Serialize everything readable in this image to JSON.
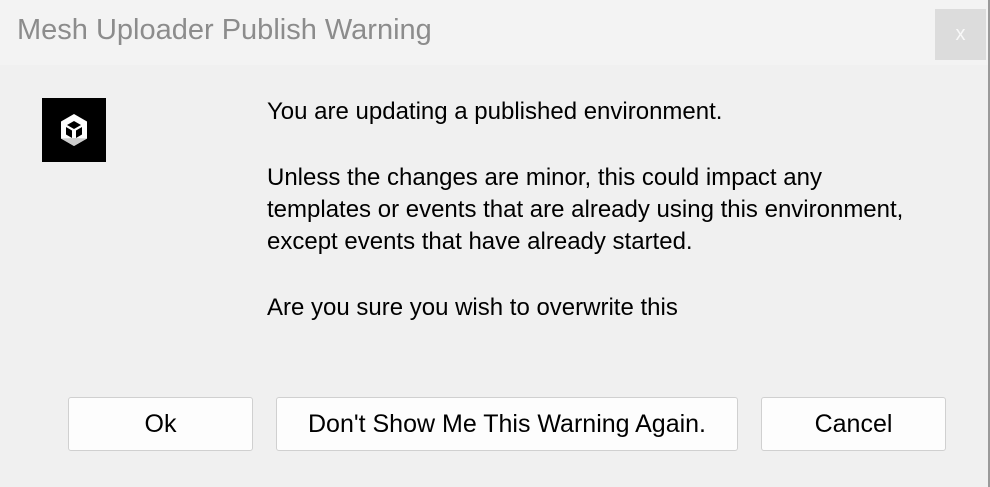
{
  "window": {
    "title": "Mesh Uploader Publish Warning",
    "close_label": "x",
    "icon": "unity-logo-icon"
  },
  "message": {
    "heading": "You are updating a published environment.",
    "body": "Unless the changes are minor, this could impact any templates or events that are already using this environment, except events that have already started.",
    "question": "Are you sure you wish to overwrite this"
  },
  "buttons": {
    "ok": "Ok",
    "dont_show": "Don't Show Me This Warning Again.",
    "cancel": "Cancel"
  }
}
